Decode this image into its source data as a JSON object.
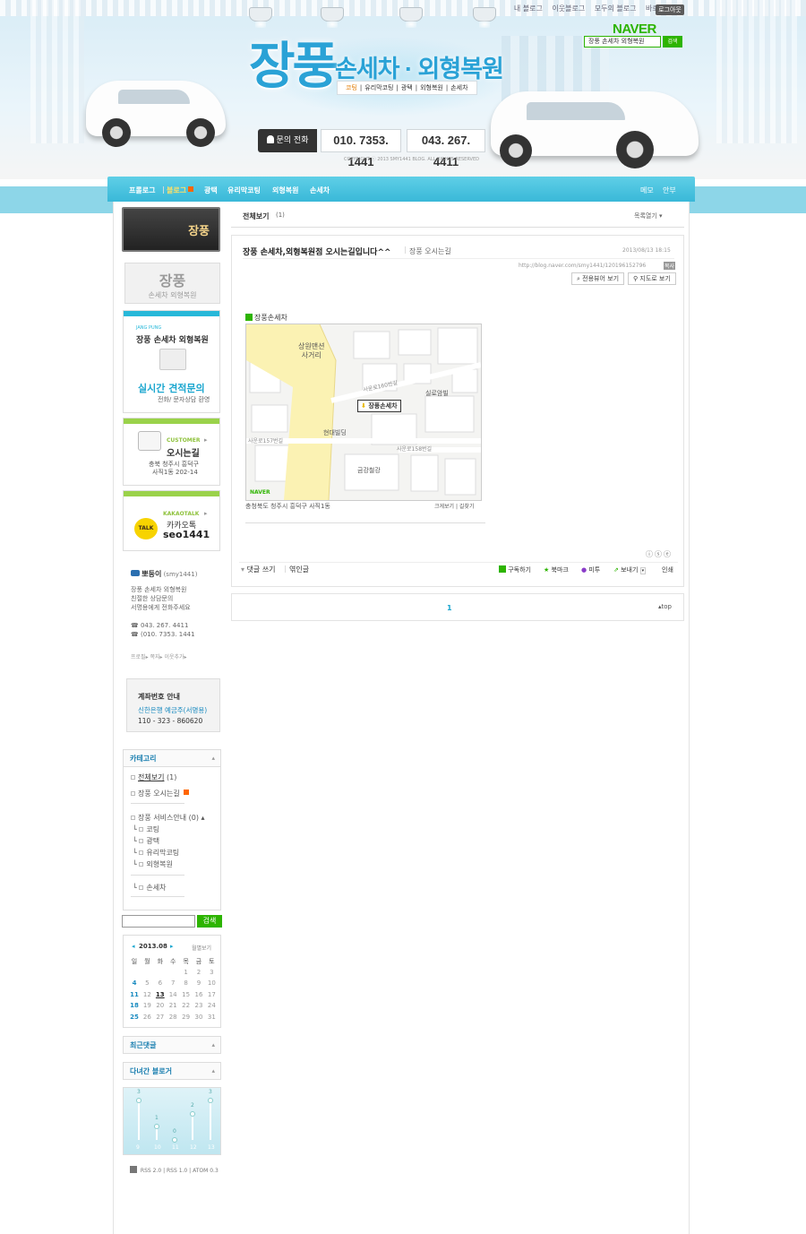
{
  "header": {
    "gnb_links": [
      "내 블로그",
      "이웃블로그",
      "모두의 블로그",
      "바로가기"
    ],
    "logout_label": "로그아웃",
    "naver_logo": "NAVER",
    "search_value": "장풍 손세차 외형복원",
    "search_button": "검색",
    "site_title": "장풍",
    "site_subtitle": "손세차 · 외형복원",
    "service_tags": [
      "코팅",
      "유리막코팅",
      "광택",
      "외형복원",
      "손세차"
    ],
    "contact_label": "문의 전화",
    "phone_1": "010. 7353. 1441",
    "phone_2": "043. 267. 4411",
    "copyright": "COPYRIGHT ⓒ 2013 SMY1441 BLOG. ALL RIGHTS RESERVED"
  },
  "nav": {
    "items": [
      "프롤로그",
      "블로그",
      "광택",
      "유리막코팅",
      "외형복원",
      "손세차"
    ],
    "right_items": [
      "메모",
      "안부"
    ]
  },
  "sidebar": {
    "profile_name": "장풍",
    "logo_title": "장풍",
    "logo_subtitle": "손세차 외형복원",
    "estimate": {
      "tag": "JANG PUNG",
      "title": "장풍 손세차 외형복원",
      "headline": "실시간 견적문의",
      "sub": "전화/ 문자상담 환영"
    },
    "customer": {
      "tag": "CUSTOMER",
      "title": "오시는길",
      "address_1": "충북 청주시 흥덕구",
      "address_2": "사직1동 202-14"
    },
    "kakao": {
      "tag": "KAKAOTALK",
      "title": "카카오톡",
      "id": "seo1441",
      "badge": "TALK"
    },
    "blogger": {
      "nickname": "뽀둥이",
      "id": "(smy1441)",
      "intro_1": "장풍 손세차 외형복원",
      "intro_2": "친절한 상담문의",
      "intro_3": "서명용에게 전화주세요",
      "phone_1": "043. 267. 4411",
      "phone_2": "(010. 7353. 1441",
      "links": [
        "프로필",
        "쪽지",
        "이웃추가"
      ]
    },
    "account": {
      "title": "계좌번호 안내",
      "bank": "신한은행   예금주(서명용)",
      "number": "110 - 323 - 860620"
    },
    "category": {
      "title": "카테고리",
      "all": "전체보기",
      "all_count": "(1)",
      "directions": "장풍 오시는길",
      "service": "장풍 서비스안내 (0)",
      "sub": [
        "코팅",
        "광택",
        "유리막코팅",
        "외형복원"
      ],
      "wash": "손세차"
    },
    "search_button": "검색",
    "calendar": {
      "month": "2013.08",
      "view_link": "월별보기",
      "weekdays": [
        "일",
        "월",
        "화",
        "수",
        "목",
        "금",
        "토"
      ],
      "weeks": [
        [
          "",
          "",
          "",
          "",
          "1",
          "2",
          "3"
        ],
        [
          "4",
          "5",
          "6",
          "7",
          "8",
          "9",
          "10"
        ],
        [
          "11",
          "12",
          "13",
          "14",
          "15",
          "16",
          "17"
        ],
        [
          "18",
          "19",
          "20",
          "21",
          "22",
          "23",
          "24"
        ],
        [
          "25",
          "26",
          "27",
          "28",
          "29",
          "30",
          "31"
        ]
      ]
    },
    "recent_comments_title": "최근댓글",
    "visited_blogs_title": "다녀간 블로거",
    "visitor_chart": {
      "days": [
        "9",
        "10",
        "11",
        "12",
        "13"
      ],
      "values": [
        3,
        1,
        0,
        2,
        3
      ]
    },
    "rss_links": [
      "RSS 2.0",
      "RSS 1.0",
      "ATOM 0.3"
    ]
  },
  "main": {
    "list_title": "전체보기",
    "list_count": "(1)",
    "list_toggle": "목록열기",
    "post": {
      "title": "장풍 손세차,외형복원점 오시는길입니다^^",
      "category": "장풍 오시는길",
      "date": "2013/08/13 18:15",
      "url": "http://blog.naver.com/smy1441/120196152796",
      "url_button": "복사",
      "view_only_button": "전용뷰어 보기",
      "map_view_button": "지도로 보기",
      "map_title": "장풍손세차",
      "map_address": "충청북도 청주시 흥덕구 사직1동",
      "map_links": "크게보기 | 길찾기",
      "map_labels": {
        "junction": "상원맨션\n사거리",
        "road_1": "사운로160번길",
        "road_2": "사운로157번길",
        "road_3": "사운로158번길",
        "b1": "현대빌딩",
        "b2": "금강철강",
        "b3": "실로암빌",
        "pin": "장풍손세차",
        "naver": "NAVER"
      },
      "comment_link": "댓글 쓰기",
      "trackback_link": "엮인글",
      "actions": [
        "구독하기",
        "북마크",
        "미투",
        "보내기",
        "인쇄"
      ]
    },
    "pager_current": "1",
    "top_link": "top"
  }
}
